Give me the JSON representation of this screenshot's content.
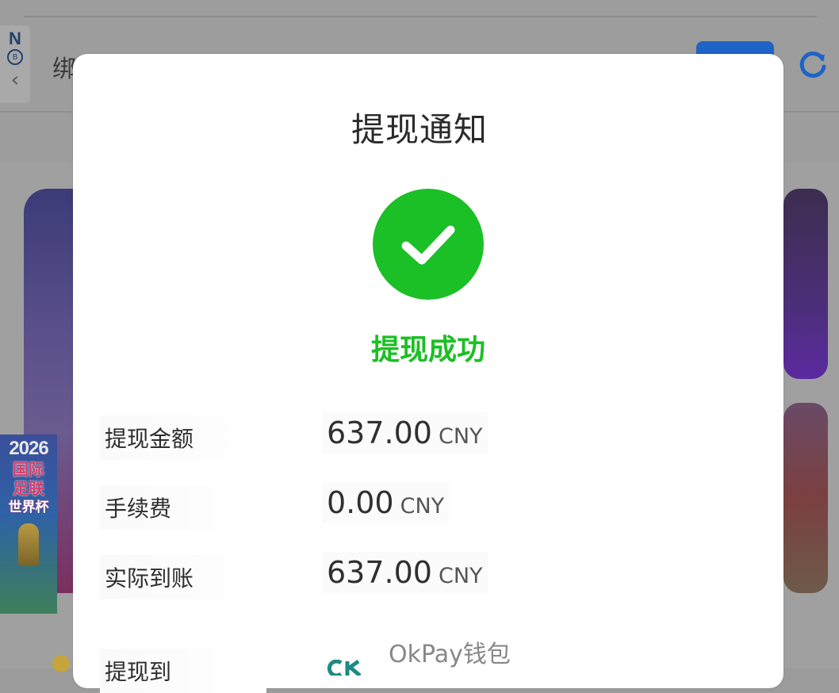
{
  "background": {
    "title_fragment": "绑",
    "side_tab": {
      "letter": "N",
      "coin_symbol": "B",
      "back_icon": "chevron-left-icon"
    },
    "refresh_icon": "refresh-icon",
    "banner": {
      "year": "2026",
      "line1": "国际",
      "line2": "足联",
      "line3": "世界杯"
    }
  },
  "dialog": {
    "title": "提现通知",
    "status_icon": "check-circle-icon",
    "status_text": "提现成功",
    "rows": [
      {
        "label": "提现金额",
        "amount": "637.00",
        "currency": "CNY"
      },
      {
        "label": "手续费",
        "amount": "0.00",
        "currency": "CNY"
      },
      {
        "label": "实际到账",
        "amount": "637.00",
        "currency": "CNY"
      }
    ],
    "destination": {
      "label": "提现到",
      "wallet_name": "OkPay钱包",
      "logo_icon": "okpay-logo-icon"
    }
  },
  "colors": {
    "success_green": "#1bbf26",
    "accent_blue": "#1e63c6",
    "dim_overlay": "#9d9d9d"
  }
}
